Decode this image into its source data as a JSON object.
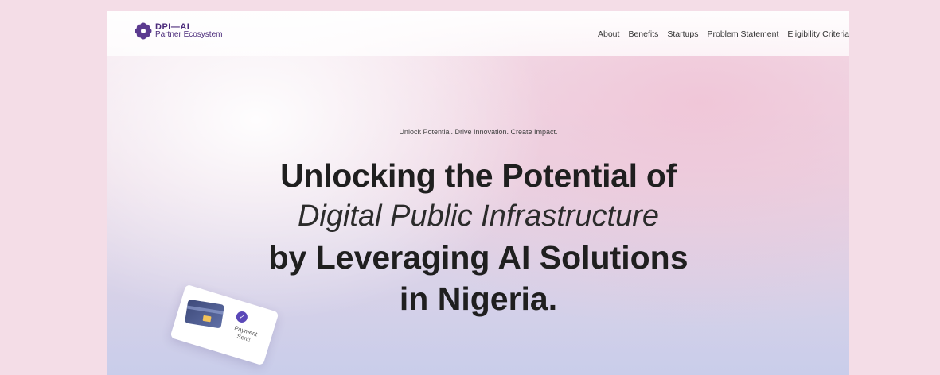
{
  "logo": {
    "line1": "DPI—AI",
    "line2": "Partner Ecosystem"
  },
  "nav": {
    "items": [
      "About",
      "Benefits",
      "Startups",
      "Problem Statement",
      "Eligibility Criteria"
    ]
  },
  "hero": {
    "eyebrow": "Unlock Potential. Drive Innovation. Create Impact.",
    "line1": "Unlocking the Potential of",
    "line2": "Digital Public Infrastructure",
    "line3": "by Leveraging AI Solutions",
    "line4": "in Nigeria."
  },
  "payment_card": {
    "text_line1": "Payment",
    "text_line2": "Sent!",
    "icon": "check-icon"
  },
  "colors": {
    "page_background": "#f4dde7",
    "brand": "#4a2a7a",
    "accent": "#5a48b8",
    "headline": "#1f1f1f"
  }
}
